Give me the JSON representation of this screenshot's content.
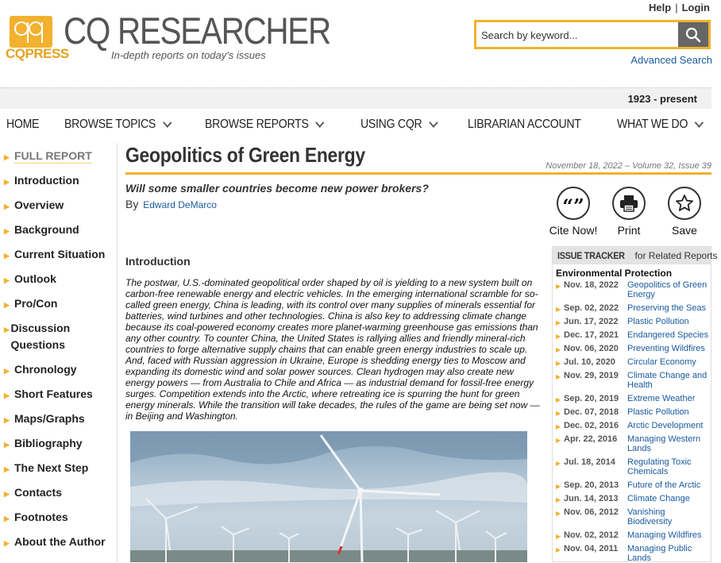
{
  "header": {
    "logo_text": "CQPRESS",
    "brand": "CQ RESEARCHER",
    "tagline": "In-depth reports on today's issues",
    "help": "Help",
    "login": "Login",
    "search_placeholder": "Search by keyword...",
    "advanced_search": "Advanced Search",
    "date_range": "1923 - present"
  },
  "nav": {
    "items": [
      {
        "label": "HOME",
        "dropdown": false
      },
      {
        "label": "BROWSE TOPICS",
        "dropdown": true
      },
      {
        "label": "BROWSE REPORTS",
        "dropdown": true
      },
      {
        "label": "USING CQR",
        "dropdown": true
      },
      {
        "label": "LIBRARIAN ACCOUNT",
        "dropdown": false
      },
      {
        "label": "WHAT WE DO",
        "dropdown": true
      }
    ]
  },
  "sidebar": {
    "items": [
      {
        "label": "FULL REPORT"
      },
      {
        "label": "Introduction"
      },
      {
        "label": "Overview"
      },
      {
        "label": "Background"
      },
      {
        "label": "Current Situation"
      },
      {
        "label": "Outlook"
      },
      {
        "label": "Pro/Con"
      },
      {
        "label": "Discussion Questions"
      },
      {
        "label": "Chronology"
      },
      {
        "label": "Short Features"
      },
      {
        "label": "Maps/Graphs"
      },
      {
        "label": "Bibliography"
      },
      {
        "label": "The Next Step"
      },
      {
        "label": "Contacts"
      },
      {
        "label": "Footnotes"
      },
      {
        "label": "About the Author"
      }
    ]
  },
  "article": {
    "title": "Geopolitics of Green Energy",
    "issue_info": "November 18, 2022 – Volume 32, Issue 39",
    "question": "Will some smaller countries become new power brokers?",
    "by": "By",
    "author": "Edward DeMarco",
    "intro_heading": "Introduction",
    "intro_text": "The postwar, U.S.-dominated geopolitical order shaped by oil is yielding to a new system built on carbon-free renewable energy and electric vehicles. In the emerging international scramble for so-called green energy, China is leading, with its control over many supplies of minerals essential for batteries, wind turbines and other technologies. China is also key to addressing climate change because its coal-powered economy creates more planet-warming greenhouse gas emissions than any other country. To counter China, the United States is rallying allies and friendly mineral-rich countries to forge alternative supply chains that can enable green energy industries to scale up. And, faced with Russian aggression in Ukraine, Europe is shedding energy ties to Moscow and expanding its domestic wind and solar power sources. Clean hydrogen may also create new energy powers — from Australia to Chile and Africa — as industrial demand for fossil-free energy surges. Competition extends into the Arctic, where retreating ice is spurring the hunt for green energy minerals. While the transition will take decades, the rules of the game are being set now — in Beijing and Washington."
  },
  "actions": {
    "cite": "Cite Now!",
    "print": "Print",
    "save": "Save"
  },
  "tracker": {
    "title_bold": "ISSUE TRACKER",
    "title_rest": "for Related Reports",
    "subheading": "Environmental Protection",
    "rows": [
      {
        "date": "Nov. 18, 2022",
        "topic": "Geopolitics of Green Energy"
      },
      {
        "date": "Sep. 02, 2022",
        "topic": "Preserving the Seas"
      },
      {
        "date": "Jun. 17, 2022",
        "topic": "Plastic Pollution"
      },
      {
        "date": "Dec. 17, 2021",
        "topic": "Endangered Species"
      },
      {
        "date": "Nov. 06, 2020",
        "topic": "Preventing Wildfires"
      },
      {
        "date": "Jul. 10, 2020",
        "topic": "Circular Economy"
      },
      {
        "date": "Nov. 29, 2019",
        "topic": "Climate Change and Health"
      },
      {
        "date": "Sep. 20, 2019",
        "topic": "Extreme Weather"
      },
      {
        "date": "Dec. 07, 2018",
        "topic": "Plastic Pollution"
      },
      {
        "date": "Dec. 02, 2016",
        "topic": "Arctic Development"
      },
      {
        "date": "Apr. 22, 2016",
        "topic": "Managing Western Lands"
      },
      {
        "date": "Jul. 18, 2014",
        "topic": "Regulating Toxic Chemicals"
      },
      {
        "date": "Sep. 20, 2013",
        "topic": "Future of the Arctic"
      },
      {
        "date": "Jun. 14, 2013",
        "topic": "Climate Change"
      },
      {
        "date": "Nov. 06, 2012",
        "topic": "Vanishing Biodiversity"
      },
      {
        "date": "Nov. 02, 2012",
        "topic": "Managing Wildfires"
      },
      {
        "date": "Nov. 04, 2011",
        "topic": "Managing Public Lands"
      }
    ]
  },
  "colors": {
    "accent": "#f2b12e",
    "link": "#1a5aa0",
    "gray": "#555555"
  }
}
